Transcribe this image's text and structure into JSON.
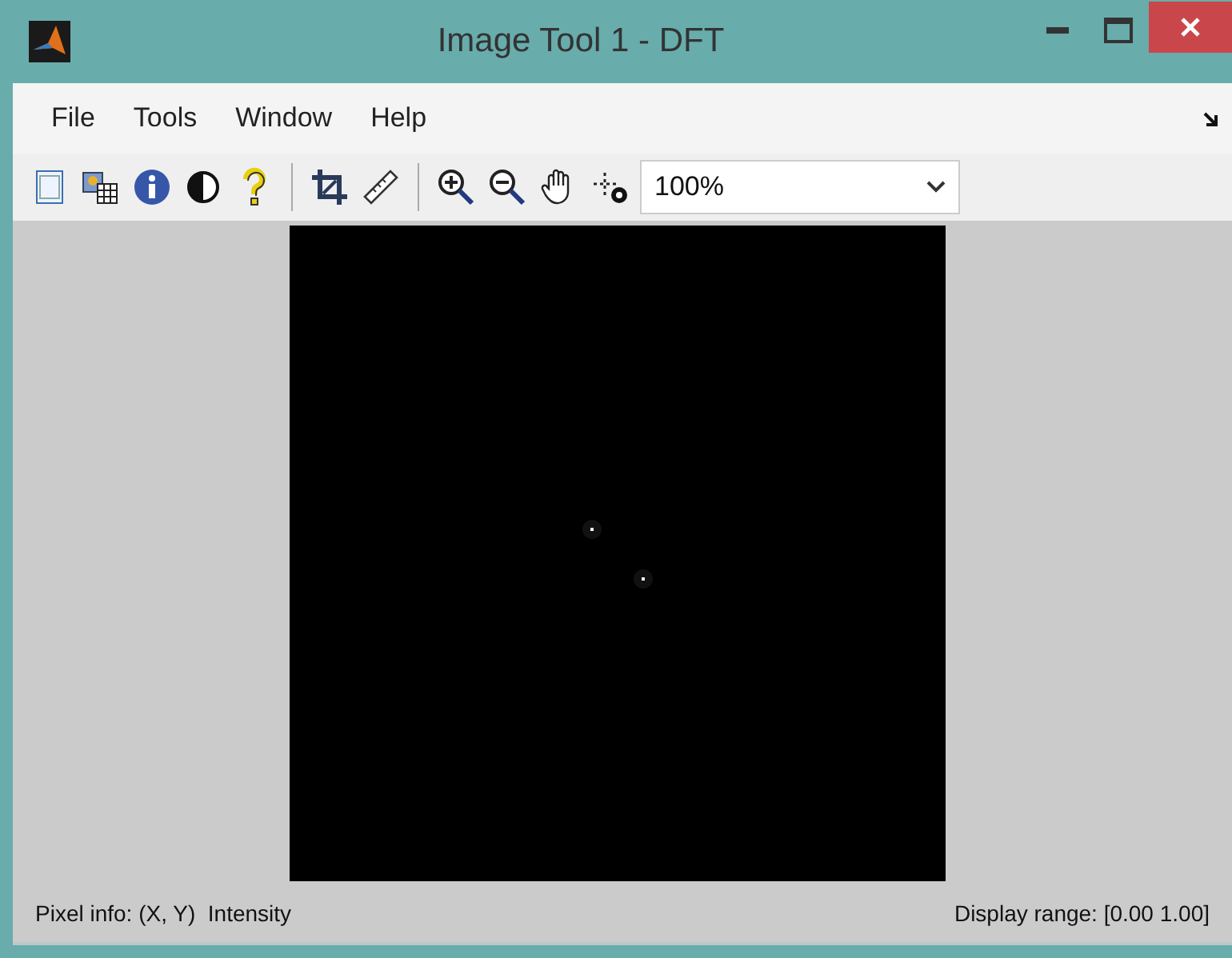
{
  "window": {
    "title": "Image Tool 1 - DFT"
  },
  "menu": [
    "File",
    "Tools",
    "Window",
    "Help"
  ],
  "zoom": {
    "value": "100%"
  },
  "status_bar": {
    "pixel_info": "Pixel info: (X, Y)  Intensity",
    "display_range": "Display range: [0.00 1.00]"
  }
}
